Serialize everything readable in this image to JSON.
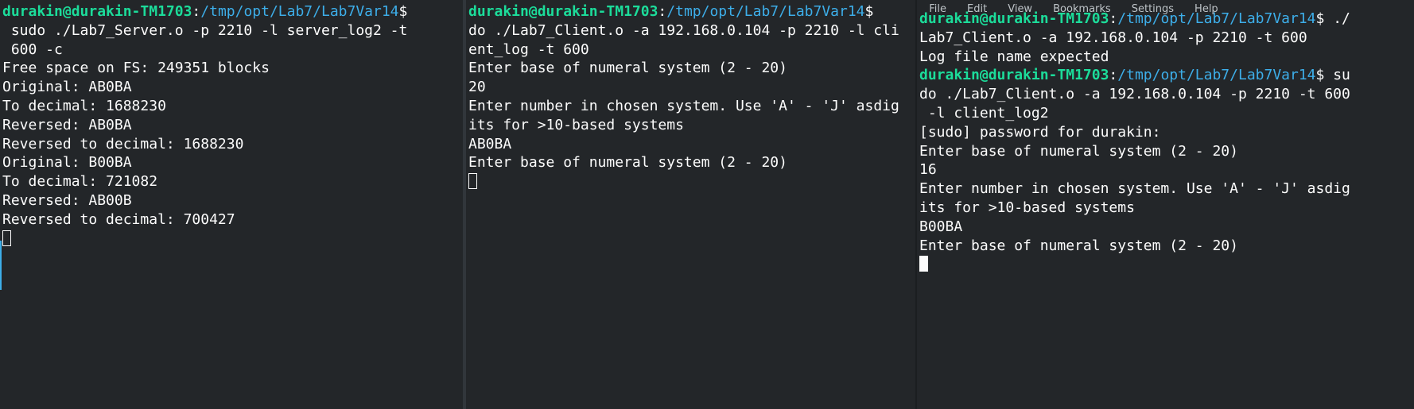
{
  "prompt": {
    "user_host": "durakin@durakin-TM1703",
    "sep": ":",
    "path": "/tmp/opt/Lab7/Lab7Var14",
    "dollar": "$"
  },
  "menubar": [
    "File",
    "Edit",
    "View",
    "Bookmarks",
    "Settings",
    "Help"
  ],
  "left_terminal": {
    "cmd_wrap_1": " sudo ./Lab7_Server.o -p 2210 -l server_log2 -t",
    "cmd_wrap_2": " 600 -c",
    "lines": [
      "Free space on FS: 249351 blocks",
      "Original: AB0BA",
      "To decimal: 1688230",
      "Reversed: AB0BA",
      "Reversed to decimal: 1688230",
      "Original: B00BA",
      "To decimal: 721082",
      "Reversed: AB00B",
      "Reversed to decimal: 700427"
    ]
  },
  "middle_terminal": {
    "lines": [
      "do ./Lab7_Client.o -a 192.168.0.104 -p 2210 -l cli",
      "ent_log -t 600",
      "Enter base of numeral system (2 - 20)",
      "20",
      "Enter number in chosen system. Use 'A' - 'J' asdig",
      "its for >10-based systems",
      "AB0BA",
      "Enter base of numeral system (2 - 20)"
    ]
  },
  "right_terminal": {
    "first_cmd": " ./",
    "lines_after_first": [
      "Lab7_Client.o -a 192.168.0.104 -p 2210 -t 600",
      "Log file name expected"
    ],
    "second_cmd": " su",
    "lines_after_second": [
      "do ./Lab7_Client.o -a 192.168.0.104 -p 2210 -t 600",
      " -l client_log2",
      "[sudo] password for durakin:",
      "Enter base of numeral system (2 - 20)",
      "16",
      "Enter number in chosen system. Use 'A' - 'J' asdig",
      "its for >10-based systems",
      "B00BA",
      "Enter base of numeral system (2 - 20)"
    ]
  }
}
